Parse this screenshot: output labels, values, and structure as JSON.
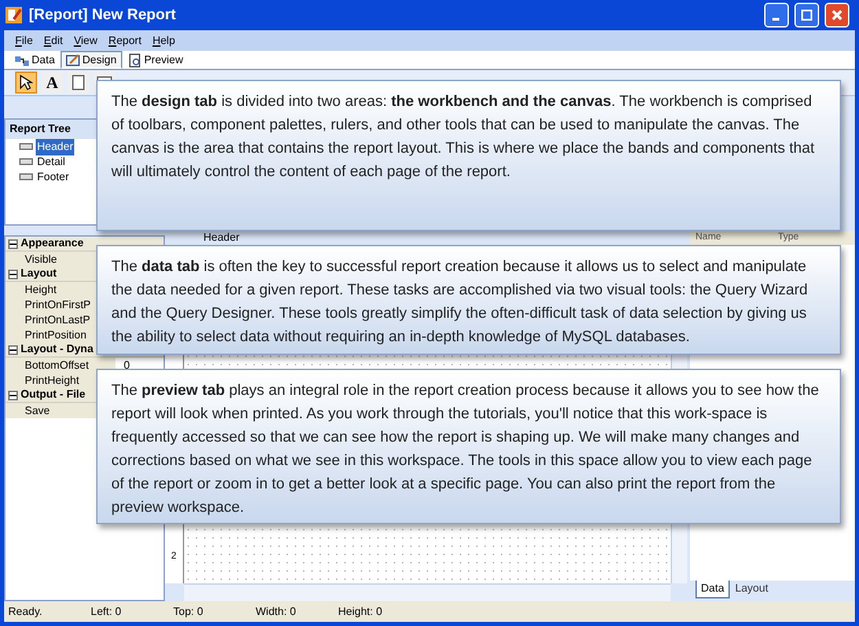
{
  "window": {
    "title": "[Report] New Report"
  },
  "menu": [
    "File",
    "Edit",
    "View",
    "Report",
    "Help"
  ],
  "tabs": [
    {
      "label": "Data",
      "selected": false,
      "kind": "data"
    },
    {
      "label": "Design",
      "selected": true,
      "kind": "design"
    },
    {
      "label": "Preview",
      "selected": false,
      "kind": "preview"
    }
  ],
  "toolbar": [
    {
      "kind": "pointer",
      "selected": true
    },
    {
      "kind": "text",
      "label": "A",
      "selected": false
    },
    {
      "kind": "page",
      "selected": false
    },
    {
      "kind": "image",
      "selected": false
    }
  ],
  "report_tree": {
    "title": "Report Tree",
    "items": [
      {
        "label": "Header",
        "selected": true
      },
      {
        "label": "Detail",
        "selected": false
      },
      {
        "label": "Footer",
        "selected": false
      }
    ]
  },
  "properties": [
    {
      "group": "Appearance",
      "expanded": true,
      "rows": [
        {
          "name": "Visible"
        }
      ]
    },
    {
      "group": "Layout",
      "expanded": true,
      "rows": [
        {
          "name": "Height"
        },
        {
          "name": "PrintOnFirstP"
        },
        {
          "name": "PrintOnLastP"
        },
        {
          "name": "PrintPosition"
        }
      ]
    },
    {
      "group": "Layout - Dyna",
      "expanded": true,
      "rows": [
        {
          "name": "BottomOffset",
          "value": "0"
        },
        {
          "name": "PrintHeight"
        }
      ]
    },
    {
      "group": "Output - File",
      "expanded": true,
      "rows": [
        {
          "name": "Save"
        }
      ]
    }
  ],
  "canvas": {
    "band": "Header",
    "ruler_label": "2"
  },
  "side_panel": {
    "columns": [
      "Name",
      "Type"
    ],
    "tabs": [
      {
        "label": "Data",
        "selected": true
      },
      {
        "label": "Layout",
        "selected": false
      }
    ]
  },
  "status_bar": [
    "Ready.",
    "Left: 0",
    "Top: 0",
    "Width: 0",
    "Height: 0"
  ],
  "callouts": [
    "The **design tab** is divided into two areas: **the workbench and the canvas**. The workbench is comprised of toolbars, component palettes, rulers, and other tools that can be used to manipulate the canvas. The canvas is the area that contains the report layout. This is where we place the bands and components that will ultimately control the content of each page of the report.",
    "The **data tab** is often the key to successful report creation because it allows us to select and manipulate the data needed for a given report.  These tasks are accomplished via two visual tools: the Query Wizard and the Query Designer. These tools greatly simplify the often-difficult task of data selection by giving us the ability to select data without requiring an in-depth knowledge of MySQL databases.",
    "The **preview tab** plays an integral role in the report creation process because it allows you to see how the report will look when printed. As you work through the tutorials, you'll notice that this work-space is frequently accessed so that we can see how the report is shaping up. We will make many changes and corrections based on what we see in this workspace. The tools in this space allow you to view each page of the report or zoom in to get a better look at a specific page. You can also print the report from the preview workspace."
  ]
}
